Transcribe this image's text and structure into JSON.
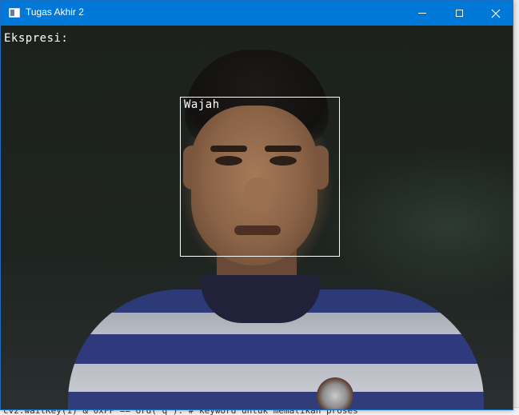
{
  "window": {
    "title": "Tugas Akhir 2",
    "controls": {
      "minimize": "minimize",
      "maximize": "maximize",
      "close": "close"
    }
  },
  "video": {
    "expression_label": "Ekspresi:",
    "face_detection": {
      "label": "Wajah",
      "box_color": "#ffffff"
    }
  },
  "background_code_snippet": "cv2.waitKey(1) & 0xFF == ord('q'): # keyword untuk mematikan proses",
  "colors": {
    "titlebar": "#0078d7",
    "overlay_text": "#ffffff"
  }
}
